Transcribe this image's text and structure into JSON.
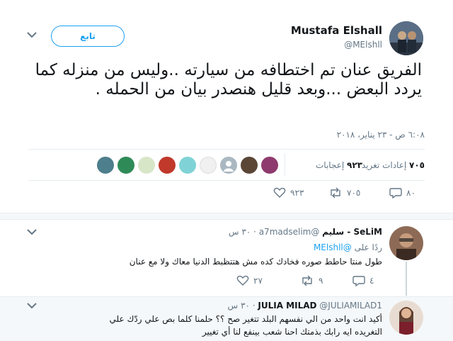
{
  "author": {
    "name": "Mustafa Elshall",
    "handle": "@MElshll",
    "follow_label": "تابع"
  },
  "tweet": {
    "text": "الفريق عنان تم اختطافه من سيارته ..وليس من منزله كما يردد البعض ...وبعد قليل هنصدر بيان من الحمله .",
    "timestamp": "٦:٠٨ ص - ٢٣ يناير، ٢٠١٨"
  },
  "stats": {
    "retweets_count": "٧٠٥",
    "retweets_label": "إعادات تغريد",
    "likes_count": "٩٢٣",
    "likes_label": "إعجابات"
  },
  "actions": {
    "reply_count": "٨٠",
    "retweet_count": "٧٠٥",
    "like_count": "٩٢٣"
  },
  "replies": [
    {
      "name": "SeLiM - سليم",
      "handle": "@a7madselim",
      "time": "٣٠ س",
      "replying_prefix": "ردًا على",
      "replying_to": "@MElshll",
      "text": "طول منتا حاطط صوره فخادك كده مش هتتظبط الدنيا معاك ولا مع عنان",
      "reply_count": "٤",
      "retweet_count": "٩",
      "like_count": "٢٧"
    },
    {
      "name": "JULIA MILAD",
      "handle": "@JULIAMILAD1",
      "time": "٣٠ س",
      "text_line1": "أكيد انت واحد من الي نفسهم البلد تتغير صح ؟؟ حلمنا كلما بص علي ردّك علي",
      "text_line2": "التغريده ايه رابك بذمتك  احنا شعب بينفع لنا أي تغيير"
    }
  ],
  "colors": {
    "accent": "#1da1f2",
    "muted": "#657786",
    "divider": "#e6ecf0"
  }
}
